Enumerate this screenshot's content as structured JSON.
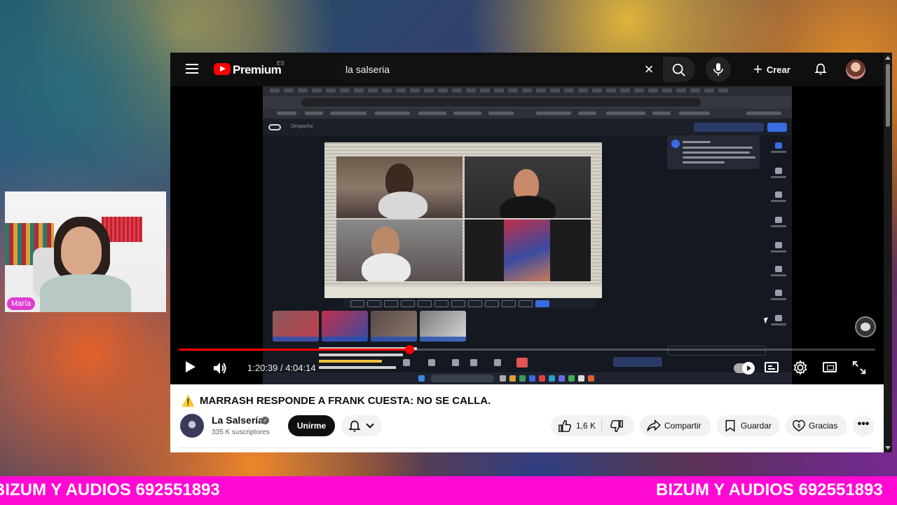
{
  "header": {
    "logo_text": "Premium",
    "logo_country": "ES",
    "search_value": "la salseria",
    "create_label": "Crear"
  },
  "player": {
    "time_display": "1:20:39 / 4:04:14",
    "progress_fraction": 0.331
  },
  "video": {
    "title": "MARRASH RESPONDE A FRANK CUESTA: NO SE CALLA.",
    "warning_icon": "⚠️"
  },
  "channel": {
    "name": "La Salsería",
    "subscribers": "335 K suscriptores",
    "join_label": "Unirme"
  },
  "actions": {
    "likes": "1,6 K",
    "share_label": "Compartir",
    "save_label": "Guardar",
    "thanks_label": "Gracias",
    "more_label": "•••"
  },
  "webcam": {
    "name_tag": "María"
  },
  "ticker": {
    "text": "BIZUM Y AUDIOS 692551893"
  },
  "colors": {
    "youtube_red": "#ff0000",
    "ticker_bg": "#ff0ad4",
    "name_tag_bg": "#e03cd1"
  },
  "icons": [
    "menu-icon",
    "youtube-logo-icon",
    "clear-icon",
    "search-icon",
    "mic-icon",
    "plus-icon",
    "bell-icon",
    "play-icon",
    "volume-icon",
    "autoplay-toggle-icon",
    "subtitles-icon",
    "gear-icon",
    "theater-icon",
    "fullscreen-icon",
    "warning-icon",
    "verified-icon",
    "like-icon",
    "dislike-icon",
    "share-icon",
    "save-icon",
    "thanks-icon",
    "more-icon"
  ]
}
